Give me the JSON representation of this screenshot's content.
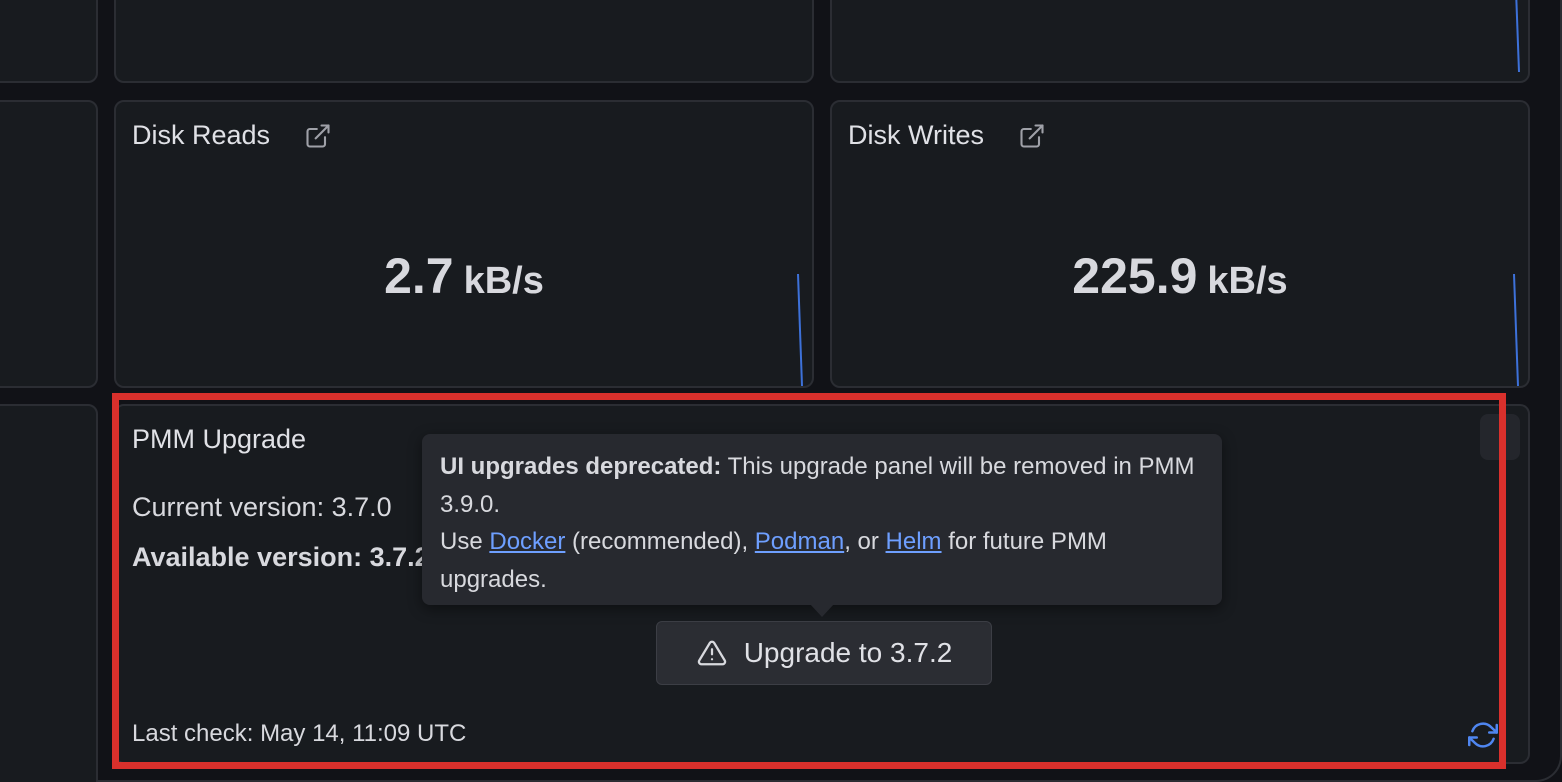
{
  "panels": {
    "disk_reads": {
      "title": "Disk Reads",
      "value": "2.7",
      "unit": "kB/s"
    },
    "disk_writes": {
      "title": "Disk Writes",
      "value": "225.9",
      "unit": "kB/s"
    }
  },
  "pmm_upgrade": {
    "title": "PMM Upgrade",
    "current_version_label": "Current version: 3.7.0",
    "available_version_label": "Available version: 3.7.2",
    "last_check": "Last check: May 14, 11:09 UTC",
    "upgrade_button_label": "Upgrade to 3.7.2"
  },
  "tooltip": {
    "heading": "UI upgrades deprecated:",
    "text1": " This upgrade panel will be removed in PMM 3.9.0.",
    "text2": "Use ",
    "link_docker": "Docker",
    "text3": " (recommended), ",
    "link_podman": "Podman",
    "text4": ", or ",
    "link_helm": "Helm",
    "text5": " for future PMM upgrades."
  },
  "colors": {
    "panel_bg": "#181b1f",
    "accent_blue": "#6e9fff",
    "highlight_red": "#d9302c",
    "sparkline_blue": "#3d71d9"
  },
  "icons": {
    "external_link": "external-link-icon",
    "warning": "warning-triangle-icon",
    "refresh": "refresh-icon"
  }
}
